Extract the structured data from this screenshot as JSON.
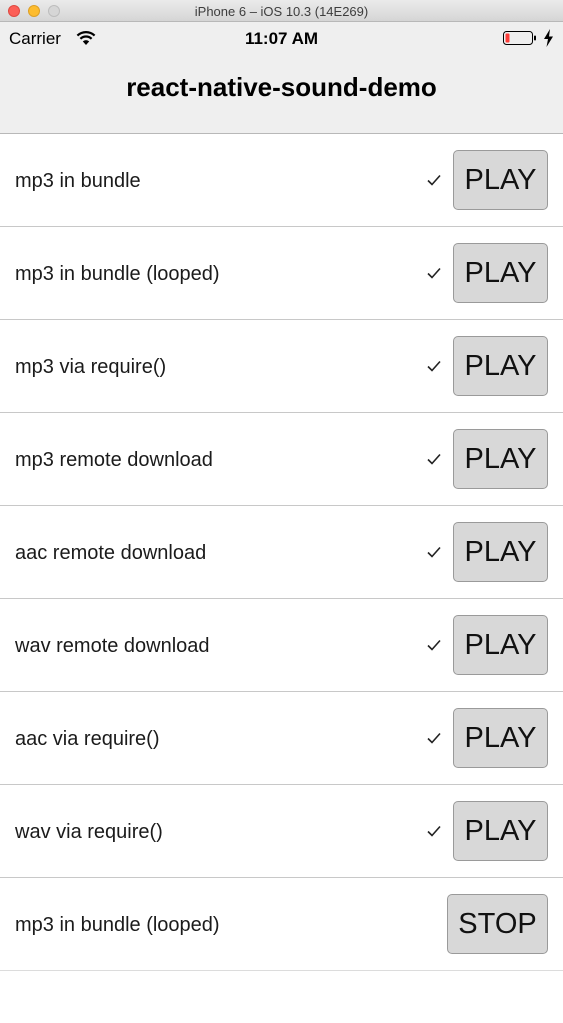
{
  "window": {
    "title": "iPhone 6 – iOS 10.3 (14E269)"
  },
  "status_bar": {
    "carrier": "Carrier",
    "time": "11:07 AM",
    "battery_color": "#fc3d39"
  },
  "header": {
    "title": "react-native-sound-demo"
  },
  "rows": [
    {
      "label": "mp3 in bundle",
      "checked": true,
      "button": "PLAY"
    },
    {
      "label": "mp3 in bundle (looped)",
      "checked": true,
      "button": "PLAY"
    },
    {
      "label": "mp3 via require()",
      "checked": true,
      "button": "PLAY"
    },
    {
      "label": "mp3 remote download",
      "checked": true,
      "button": "PLAY"
    },
    {
      "label": "aac remote download",
      "checked": true,
      "button": "PLAY"
    },
    {
      "label": "wav remote download",
      "checked": true,
      "button": "PLAY"
    },
    {
      "label": "aac via require()",
      "checked": true,
      "button": "PLAY"
    },
    {
      "label": "wav via require()",
      "checked": true,
      "button": "PLAY"
    },
    {
      "label": "mp3 in bundle (looped)",
      "checked": false,
      "button": "STOP"
    }
  ]
}
